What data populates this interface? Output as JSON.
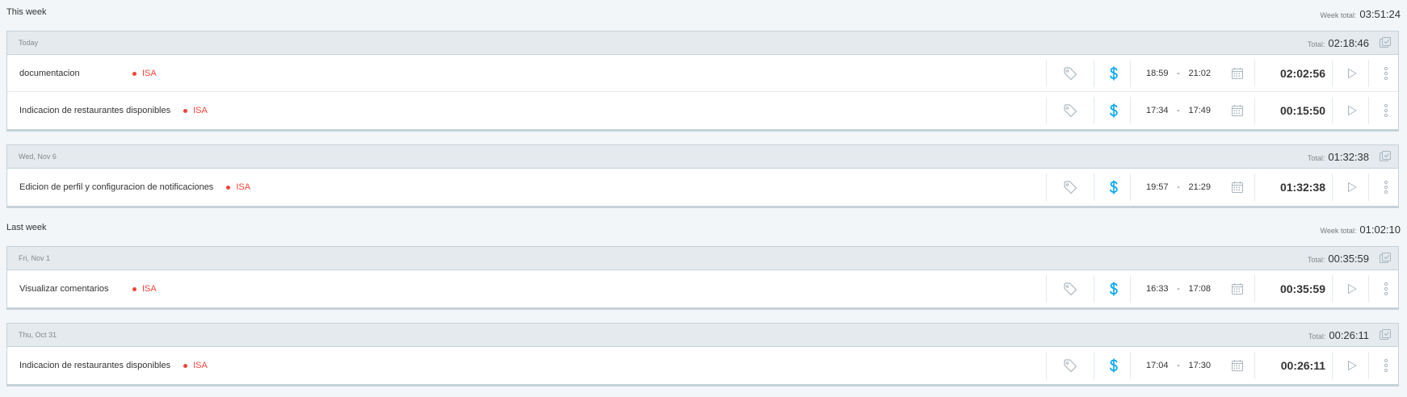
{
  "weeks": [
    {
      "title": "This week",
      "total_label": "Week total:",
      "total": "03:51:24",
      "days": [
        {
          "label": "Today",
          "total_label": "Total:",
          "total": "02:18:46",
          "entries": [
            {
              "description": "documentacion",
              "project": "ISA",
              "start": "18:59",
              "end": "21:02",
              "duration": "02:02:56"
            },
            {
              "description": "Indicacion de restaurantes disponibles",
              "project": "ISA",
              "start": "17:34",
              "end": "17:49",
              "duration": "00:15:50"
            }
          ]
        },
        {
          "label": "Wed, Nov 6",
          "total_label": "Total:",
          "total": "01:32:38",
          "entries": [
            {
              "description": "Edicion de perfil y configuracion de notificaciones",
              "project": "ISA",
              "start": "19:57",
              "end": "21:29",
              "duration": "01:32:38"
            }
          ]
        }
      ]
    },
    {
      "title": "Last week",
      "total_label": "Week total:",
      "total": "01:02:10",
      "days": [
        {
          "label": "Fri, Nov 1",
          "total_label": "Total:",
          "total": "00:35:59",
          "entries": [
            {
              "description": "Visualizar comentarios",
              "project": "ISA",
              "start": "16:33",
              "end": "17:08",
              "duration": "00:35:59"
            }
          ]
        },
        {
          "label": "Thu, Oct 31",
          "total_label": "Total:",
          "total": "00:26:11",
          "entries": [
            {
              "description": "Indicacion de restaurantes disponibles",
              "project": "ISA",
              "start": "17:04",
              "end": "17:30",
              "duration": "00:26:11"
            }
          ]
        }
      ]
    }
  ],
  "time_separator": "-",
  "icons": {
    "tag": "tag-icon",
    "billable": "dollar-icon",
    "calendar": "calendar-icon",
    "play": "play-icon",
    "more": "more-vertical-icon",
    "bulk_edit": "bulk-edit-icon"
  },
  "colors": {
    "project": "#f44336",
    "billable": "#03a9f4",
    "background": "#f2f6f8",
    "day_header": "#e4eaee"
  }
}
